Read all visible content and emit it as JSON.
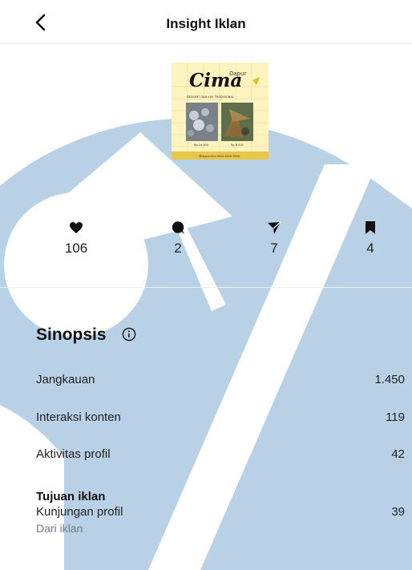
{
  "header": {
    "title": "Insight Iklan"
  },
  "ad_thumbnail": {
    "brand_small": "Dapur",
    "brand": "Cima",
    "subtitle": "DESSERT DAN KUE TRADISIONAL",
    "caption_left": "Rp 10.000",
    "caption_right": "Rp 8.000",
    "footer": "@dapurcima   0812-3456-7890"
  },
  "stats": {
    "likes": "106",
    "comments": "2",
    "shares": "7",
    "saves": "4"
  },
  "synopsis": {
    "title": "Sinopsis",
    "rows": [
      {
        "label": "Jangkauan",
        "value": "1.450"
      },
      {
        "label": "Interaksi konten",
        "value": "119"
      },
      {
        "label": "Aktivitas profil",
        "value": "42"
      }
    ],
    "goal": {
      "title": "Tujuan iklan",
      "label": "Kunjungan profil",
      "sublabel": "Dari iklan",
      "value": "39"
    }
  },
  "colors": {
    "watermark": "#b9d1e6",
    "thumbnail_bg": "#fff3bf",
    "muted_text": "#6f7a86"
  }
}
